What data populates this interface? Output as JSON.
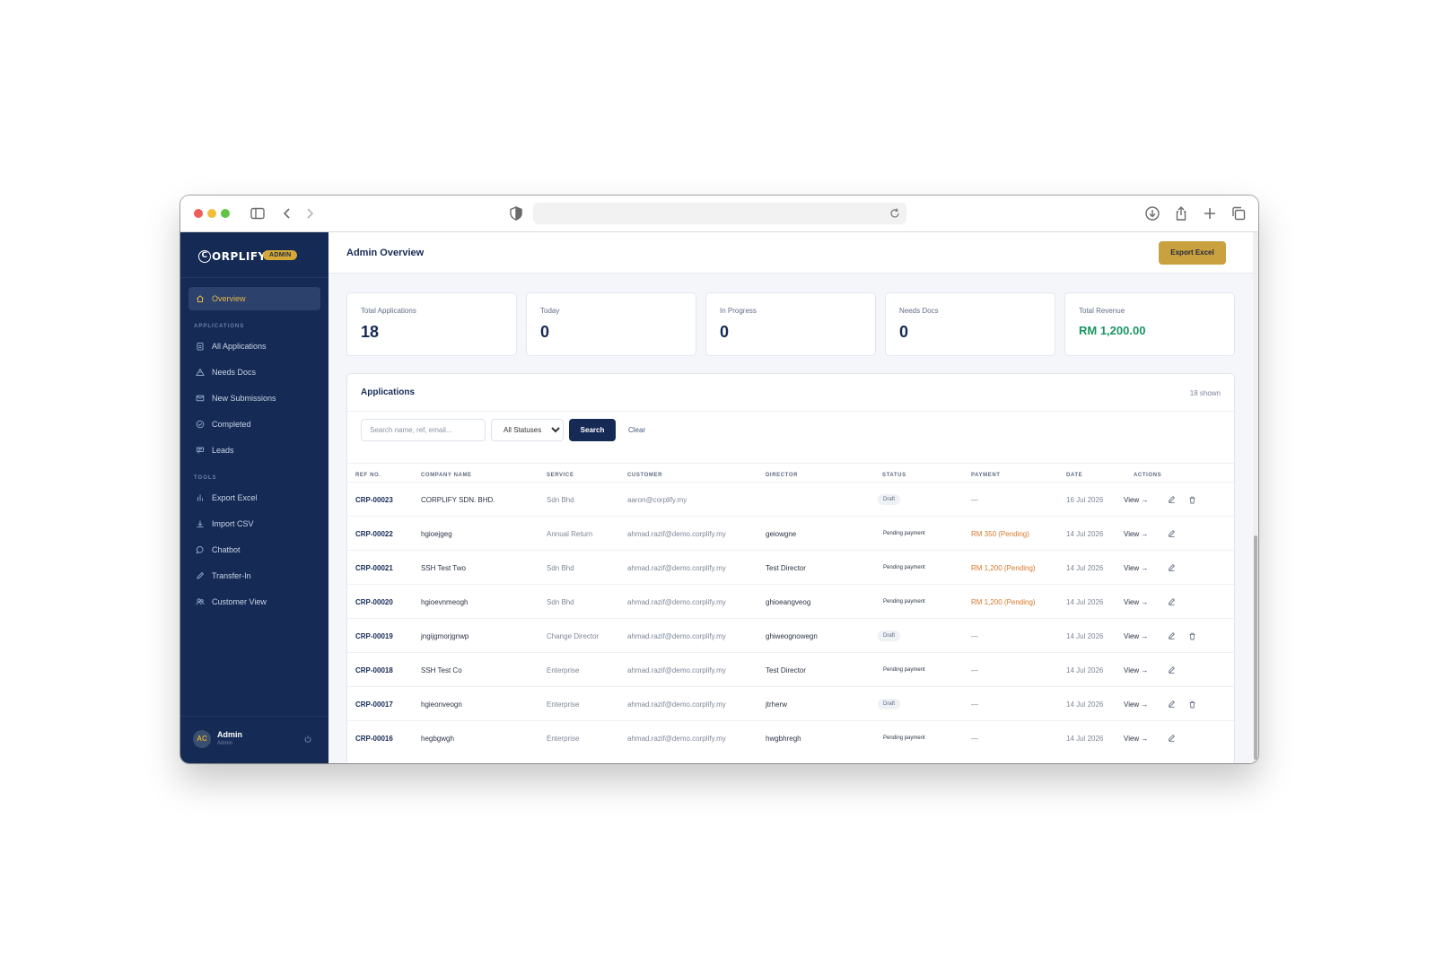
{
  "brand": {
    "logo_text": "ORPLIFY",
    "logo_initial": "C",
    "badge": "ADMIN"
  },
  "sidebar": {
    "items": [
      {
        "label": "Overview",
        "icon": "home-icon"
      }
    ],
    "sections": [
      {
        "label": "APPLICATIONS",
        "items": [
          {
            "label": "All Applications",
            "icon": "clipboard-icon"
          },
          {
            "label": "Needs Docs",
            "icon": "warning-icon"
          },
          {
            "label": "New Submissions",
            "icon": "mail-icon"
          },
          {
            "label": "Completed",
            "icon": "check-circle-icon"
          },
          {
            "label": "Leads",
            "icon": "list-icon"
          }
        ]
      },
      {
        "label": "TOOLS",
        "items": [
          {
            "label": "Export Excel",
            "icon": "bar-chart-icon"
          },
          {
            "label": "Import CSV",
            "icon": "download-icon"
          },
          {
            "label": "Chatbot",
            "icon": "chat-icon"
          },
          {
            "label": "Transfer-In",
            "icon": "pencil-icon"
          },
          {
            "label": "Customer View",
            "icon": "users-icon"
          }
        ]
      }
    ],
    "user": {
      "initials": "AC",
      "name": "Admin",
      "role": "Admin"
    }
  },
  "header": {
    "title": "Admin Overview",
    "export_label": "Export Excel"
  },
  "stats": [
    {
      "label": "Total Applications",
      "value": "18"
    },
    {
      "label": "Today",
      "value": "0"
    },
    {
      "label": "In Progress",
      "value": "0"
    },
    {
      "label": "Needs Docs",
      "value": "0"
    },
    {
      "label": "Total Revenue",
      "value": "RM 1,200.00"
    }
  ],
  "applications": {
    "title": "Applications",
    "count_text": "18 shown",
    "search_placeholder": "Search name, ref, email...",
    "status_selected": "All Statuses",
    "search_label": "Search",
    "clear_label": "Clear",
    "columns": [
      "REF NO.",
      "COMPANY NAME",
      "SERVICE",
      "CUSTOMER",
      "DIRECTOR",
      "STATUS",
      "PAYMENT",
      "DATE",
      "ACTIONS"
    ],
    "view_label": "View →",
    "rows": [
      {
        "ref": "CRP-00023",
        "company": "CORPLIFY SDN. BHD.",
        "service": "Sdn Bhd",
        "customer": "aaron@corplify.my",
        "director": "",
        "status": "Draft",
        "status_type": "draft",
        "payment": "—",
        "payment_type": "none",
        "date": "16 Jul 2026",
        "deletable": true
      },
      {
        "ref": "CRP-00022",
        "company": "hgioejgeg",
        "service": "Annual Return",
        "customer": "ahmad.razif@demo.corplify.my",
        "director": "geiowgne",
        "status": "Pending payment",
        "status_type": "pending",
        "payment": "RM 350 (Pending)",
        "payment_type": "pending",
        "date": "14 Jul 2026",
        "deletable": false
      },
      {
        "ref": "CRP-00021",
        "company": "SSH Test Two",
        "service": "Sdn Bhd",
        "customer": "ahmad.razif@demo.corplify.my",
        "director": "Test Director",
        "status": "Pending payment",
        "status_type": "pending",
        "payment": "RM 1,200 (Pending)",
        "payment_type": "pending",
        "date": "14 Jul 2026",
        "deletable": false
      },
      {
        "ref": "CRP-00020",
        "company": "hgioevnmeogh",
        "service": "Sdn Bhd",
        "customer": "ahmad.razif@demo.corplify.my",
        "director": "ghioeangveog",
        "status": "Pending payment",
        "status_type": "pending",
        "payment": "RM 1,200 (Pending)",
        "payment_type": "pending",
        "date": "14 Jul 2026",
        "deletable": false
      },
      {
        "ref": "CRP-00019",
        "company": "jngijgmorjgnwp",
        "service": "Change Director",
        "customer": "ahmad.razif@demo.corplify.my",
        "director": "ghiweognowegn",
        "status": "Draft",
        "status_type": "draft",
        "payment": "—",
        "payment_type": "none",
        "date": "14 Jul 2026",
        "deletable": true
      },
      {
        "ref": "CRP-00018",
        "company": "SSH Test Co",
        "service": "Enterprise",
        "customer": "ahmad.razif@demo.corplify.my",
        "director": "Test Director",
        "status": "Pending payment",
        "status_type": "pending",
        "payment": "—",
        "payment_type": "none",
        "date": "14 Jul 2026",
        "deletable": false
      },
      {
        "ref": "CRP-00017",
        "company": "hgieonveogn",
        "service": "Enterprise",
        "customer": "ahmad.razif@demo.corplify.my",
        "director": "jtrherw",
        "status": "Draft",
        "status_type": "draft",
        "payment": "—",
        "payment_type": "none",
        "date": "14 Jul 2026",
        "deletable": true
      },
      {
        "ref": "CRP-00016",
        "company": "hegbgwgh",
        "service": "Enterprise",
        "customer": "ahmad.razif@demo.corplify.my",
        "director": "hwgbhregh",
        "status": "Pending payment",
        "status_type": "pending",
        "payment": "—",
        "payment_type": "none",
        "date": "14 Jul 2026",
        "deletable": false
      }
    ]
  },
  "colors": {
    "sidebar": "#152a55",
    "accent": "#c9a13f",
    "revenue": "#1a9561",
    "pending_payment": "#d6782a"
  }
}
